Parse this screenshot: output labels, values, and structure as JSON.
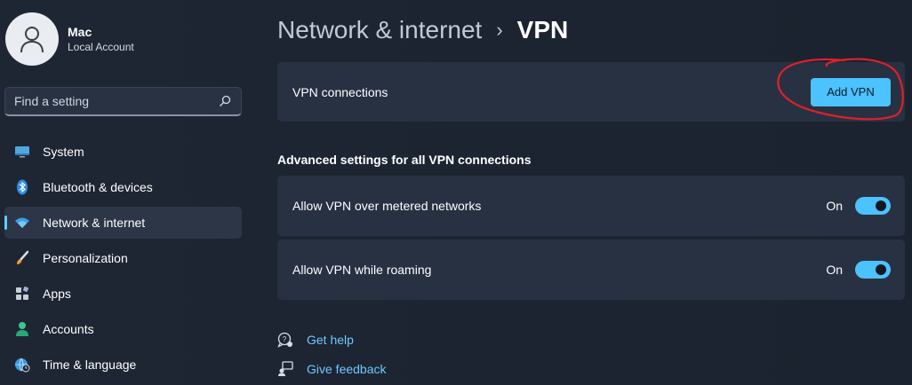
{
  "profile": {
    "name": "Mac",
    "account_type": "Local Account"
  },
  "search": {
    "placeholder": "Find a setting"
  },
  "sidebar": {
    "items": [
      {
        "label": "System",
        "icon": "monitor-icon"
      },
      {
        "label": "Bluetooth & devices",
        "icon": "bluetooth-icon"
      },
      {
        "label": "Network & internet",
        "icon": "wifi-icon",
        "active": true
      },
      {
        "label": "Personalization",
        "icon": "brush-icon"
      },
      {
        "label": "Apps",
        "icon": "apps-icon"
      },
      {
        "label": "Accounts",
        "icon": "person-icon"
      },
      {
        "label": "Time & language",
        "icon": "globe-clock-icon"
      }
    ]
  },
  "breadcrumb": {
    "parent": "Network & internet",
    "separator": "›",
    "current": "VPN"
  },
  "vpn_connections": {
    "label": "VPN connections",
    "button_label": "Add VPN"
  },
  "advanced": {
    "heading": "Advanced settings for all VPN connections",
    "metered": {
      "label": "Allow VPN over metered networks",
      "state": "On",
      "enabled": true
    },
    "roaming": {
      "label": "Allow VPN while roaming",
      "state": "On",
      "enabled": true
    }
  },
  "links": {
    "help": "Get help",
    "feedback": "Give feedback"
  },
  "colors": {
    "accent": "#4cc2ff",
    "annotation": "#e0202a",
    "background": "#1c2431",
    "card": "#283142"
  }
}
